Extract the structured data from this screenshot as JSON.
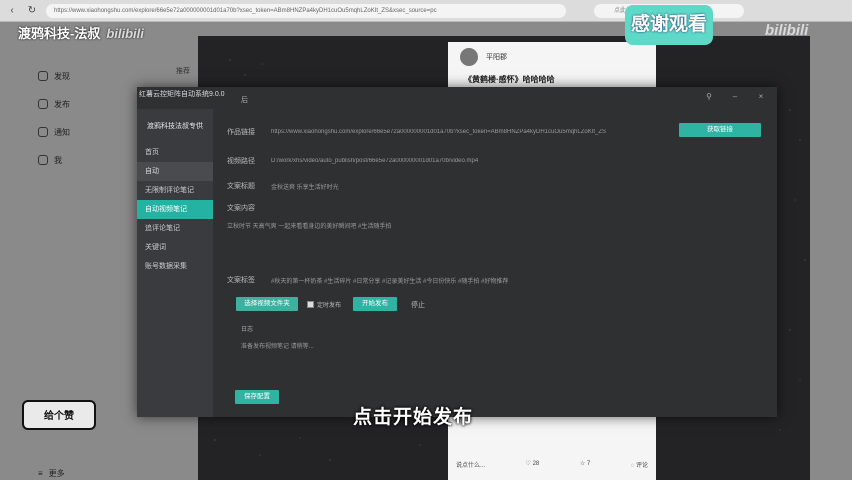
{
  "browser": {
    "url": "https://www.xiaohongshu.com/explore/66e5e72a000000001d01a70b?xsec_token=ABm8HNZPa4kyDH1cuOu5mqhLZoKIt_ZS&xsec_source=pc",
    "search_placeholder": "点此搜索"
  },
  "watermark": {
    "channel": "渡鸦科技-法叔",
    "bili": "bilibili"
  },
  "bg_sidebar": {
    "items": [
      {
        "label": "发现"
      },
      {
        "label": "发布"
      },
      {
        "label": "通知"
      },
      {
        "label": "我"
      }
    ],
    "more": "更多"
  },
  "bg_top_tags": {
    "left": "推荐",
    "right": "推荐"
  },
  "post": {
    "author": "平阳郡",
    "title": "《黄鹤楼·感怀》哈哈哈哈",
    "comment_placeholder": "说点什么...",
    "likes": "28",
    "collects": "7",
    "comments": "评论"
  },
  "tool": {
    "window_title": "红薯云控矩阵自动系统9.0.0",
    "title_bar_text": "后",
    "sidebar": {
      "brand": "渡鸦科技法叔专供",
      "items": [
        {
          "label": "首页",
          "state": "normal"
        },
        {
          "label": "自动",
          "state": "group"
        },
        {
          "label": "无限制评论笔记",
          "state": "normal"
        },
        {
          "label": "自动视频笔记",
          "state": "active"
        },
        {
          "label": "追评论笔记",
          "state": "normal"
        },
        {
          "label": "关键词",
          "state": "normal"
        },
        {
          "label": "账号数据采集",
          "state": "normal"
        }
      ]
    },
    "form": {
      "link_label": "作品链接",
      "link_value": "https://www.xiaohongshu.com/explore/66e5e72a000000001d01a70b?xsec_token=ABm8HNZPa4kyDH1cuOu5mqhLZoKIt_ZS",
      "parse_button": "获取链接",
      "video_label": "视频路径",
      "video_value": "D:/work/xhs/video/auto_publish/post/66e5e72a000000001d01a70b/video.mp4",
      "title_label": "文案标题",
      "title_value": "金秋送爽 乐享生活好时光",
      "body_label": "文案内容",
      "body_value": "立秋时节 天高气爽 一起来看看身边的美好瞬间吧 #生活随手拍",
      "tags_label": "文案标签",
      "tags_value": "#秋天的第一杯奶茶 #生活碎片 #日常分享 #记录美好生活 #今日份快乐 #随手拍 #好物推荐",
      "choose_button": "选择视频文件夹",
      "checkbox_label": "定时发布",
      "publish_button": "开始发布",
      "publish_extra": "停止",
      "log_label": "日志",
      "log_value": "准备发布视频笔记 请稍等...",
      "save_button": "保存配置"
    }
  },
  "subtitle": "点击开始发布",
  "badges": {
    "thanks": "感谢观看",
    "thanks_bili": "bilibili",
    "follow": "给个赞"
  },
  "colors": {
    "accent": "#2fb3a3",
    "tool_bg": "#2f3032",
    "sidebar_bg": "#3a3b3e"
  }
}
